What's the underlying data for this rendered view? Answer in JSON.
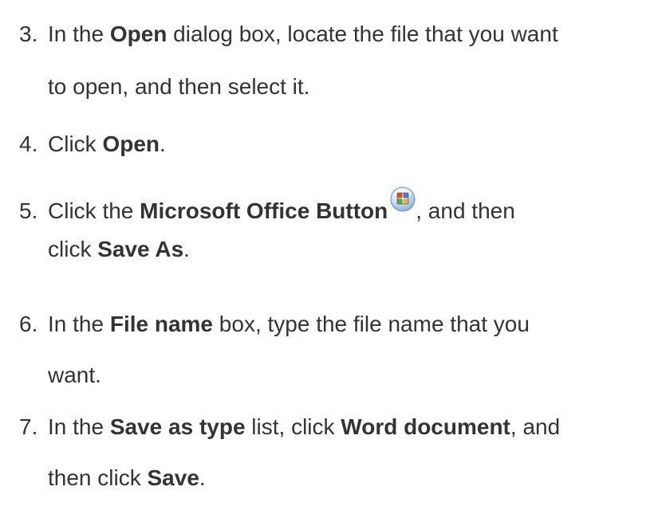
{
  "steps": [
    {
      "number": "3.",
      "line1": [
        "In the ",
        "Open",
        " dialog box, locate the file that you want"
      ],
      "line2": "to open, and then select it."
    },
    {
      "number": "4.",
      "line1": [
        "Click ",
        "Open",
        "."
      ]
    },
    {
      "number": "5.",
      "line1": [
        "Click the ",
        "Microsoft Office Button",
        ", and then"
      ],
      "line2": [
        "click ",
        "Save As",
        "."
      ],
      "icon": "microsoft-office-button-icon"
    },
    {
      "number": "6.",
      "line1": [
        "In the ",
        "File name",
        " box, type the file name that you"
      ],
      "line2": "want."
    },
    {
      "number": "7.",
      "line1": [
        "In the ",
        "Save as type",
        " list, click ",
        "Word document",
        ", and"
      ],
      "line2": [
        "then click ",
        "Save",
        "."
      ]
    }
  ]
}
